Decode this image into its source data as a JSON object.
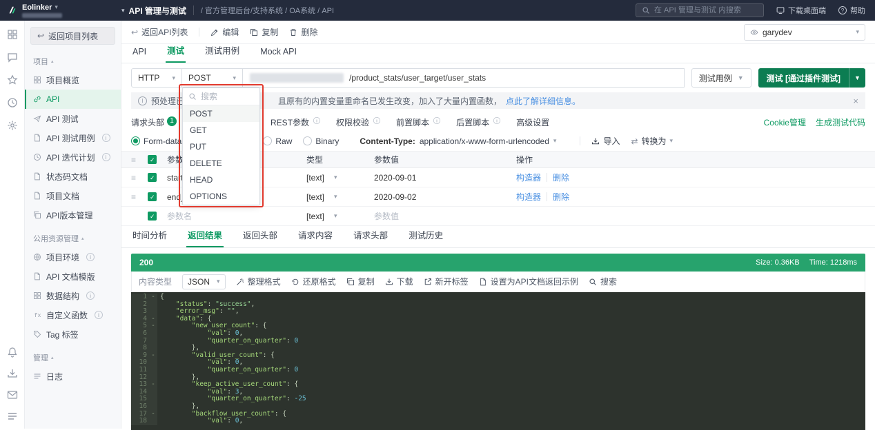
{
  "topbar": {
    "logo_text": "Eolinker",
    "app_menu": "API 管理与测试",
    "breadcrumb": "/ 官方管理后台/支持系统 / OA系统 / API",
    "search_placeholder": "在 API 管理与测试 内搜索",
    "download_desktop": "下载桌面端",
    "help": "帮助"
  },
  "icon_rail": {
    "top": [
      {
        "name": "apps-icon",
        "sym": "sy-grid"
      },
      {
        "name": "messages-icon",
        "sym": "sy-chat"
      },
      {
        "name": "favorites-icon",
        "sym": "sy-star"
      },
      {
        "name": "history-icon",
        "sym": "sy-clock"
      },
      {
        "name": "settings-icon",
        "sym": "sy-gear"
      }
    ],
    "bottom": [
      {
        "name": "notifications-icon",
        "sym": "sy-bell"
      },
      {
        "name": "download-client-icon",
        "sym": "sy-tray"
      },
      {
        "name": "feedback-icon",
        "sym": "sy-mail"
      },
      {
        "name": "menu-icon",
        "sym": "sy-list"
      }
    ]
  },
  "sidebar": {
    "back_to_projects": "返回项目列表",
    "sections": [
      {
        "title": "项目",
        "items": [
          {
            "label": "项目概览",
            "icon": "project-overview-item",
            "sym": "sy-grid"
          },
          {
            "label": "API",
            "icon": "api-item",
            "sym": "sy-link",
            "active": true
          },
          {
            "label": "API 测试",
            "icon": "api-test-item",
            "sym": "sy-send"
          },
          {
            "label": "API 测试用例",
            "icon": "api-test-case-item",
            "sym": "sy-file",
            "info": true
          },
          {
            "label": "API 迭代计划",
            "icon": "api-iteration-item",
            "sym": "sy-clock",
            "info": true
          },
          {
            "label": "状态码文档",
            "icon": "status-code-doc-item",
            "sym": "sy-file"
          },
          {
            "label": "项目文档",
            "icon": "project-doc-item",
            "sym": "sy-file"
          },
          {
            "label": "API版本管理",
            "icon": "api-version-item",
            "sym": "sy-copy"
          }
        ]
      },
      {
        "title": "公用资源管理",
        "items": [
          {
            "label": "项目环境",
            "icon": "project-env-item",
            "sym": "sy-globe",
            "info": true
          },
          {
            "label": "API 文档模版",
            "icon": "doc-template-item",
            "sym": "sy-file"
          },
          {
            "label": "数据结构",
            "icon": "data-structure-item",
            "sym": "sy-grid",
            "info": true
          },
          {
            "label": "自定义函数",
            "icon": "custom-function-item",
            "sym": "sy-fx",
            "info": true
          },
          {
            "label": "Tag 标签",
            "icon": "tag-item",
            "sym": "sy-tag"
          }
        ]
      },
      {
        "title": "管理",
        "items": [
          {
            "label": "日志",
            "icon": "log-item",
            "sym": "sy-list"
          }
        ]
      }
    ]
  },
  "detail_toolbar": {
    "back": "返回API列表",
    "edit": "编辑",
    "copy": "复制",
    "delete": "删除",
    "env_select": "garydev"
  },
  "page_tabs": [
    {
      "label": "API"
    },
    {
      "label": "测试",
      "active": true
    },
    {
      "label": "测试用例"
    },
    {
      "label": "Mock API"
    }
  ],
  "request_bar": {
    "protocol": "HTTP",
    "method": "POST",
    "path": "/product_stats/user_target/user_stats",
    "test_case_button": "测试用例",
    "test_button": "测试 [通过插件测试]"
  },
  "method_dropdown": {
    "search_placeholder": "搜索",
    "options": [
      {
        "label": "POST",
        "selected": true
      },
      {
        "label": "GET"
      },
      {
        "label": "PUT"
      },
      {
        "label": "DELETE"
      },
      {
        "label": "HEAD"
      },
      {
        "label": "OPTIONS"
      }
    ]
  },
  "notice": {
    "left_text": "预处理已更",
    "right_text": "且原有的内置变量重命名已发生改变，加入了大量内置函数，",
    "link_text": "点此了解详细信息。"
  },
  "request_tabs": {
    "headers_tab": "请求头部",
    "headers_badge": "1",
    "tabs": [
      {
        "label": "REST参数",
        "info": true
      },
      {
        "label": "权限校验",
        "info": true
      },
      {
        "label": "前置脚本",
        "info": true
      },
      {
        "label": "后置脚本",
        "info": true
      },
      {
        "label": "高级设置"
      }
    ],
    "cookie_link": "Cookie管理",
    "gen_code_link": "生成测试代码"
  },
  "body_options": {
    "radios": [
      {
        "label": "Form-data",
        "selected": true,
        "gap_after": true
      },
      {
        "label": "Raw"
      },
      {
        "label": "Binary"
      }
    ],
    "content_type_label": "Content-Type:",
    "content_type_value": "application/x-www-form-urlencoded",
    "import_label": "导入",
    "convert_label": "转换为"
  },
  "param_table": {
    "headers": {
      "name": "参数名",
      "type": "类型",
      "value": "参数值",
      "ops": "操作"
    },
    "rows": [
      {
        "name": "start_time",
        "type": "[text]",
        "value": "2020-09-01",
        "checked": true
      },
      {
        "name": "end_time",
        "type": "[text]",
        "value": "2020-09-02",
        "checked": true
      }
    ],
    "empty_row": {
      "name_placeholder": "参数名",
      "type": "[text]",
      "value_placeholder": "参数值",
      "checked": true
    },
    "ops": {
      "builder": "构造器",
      "delete": "删除"
    }
  },
  "result_tabs": [
    {
      "label": "时间分析"
    },
    {
      "label": "返回结果",
      "active": true
    },
    {
      "label": "返回头部"
    },
    {
      "label": "请求内容"
    },
    {
      "label": "请求头部"
    },
    {
      "label": "测试历史"
    }
  ],
  "result": {
    "status_code": "200",
    "size_text": "Size: 0.36KB",
    "time_text": "Time: 1218ms",
    "content_type_label": "内容类型",
    "content_type_value": "JSON",
    "actions": [
      {
        "label": "整理格式",
        "icon": "format-icon",
        "sym": "sy-wand"
      },
      {
        "label": "还原格式",
        "icon": "restore-icon",
        "sym": "sy-restore"
      },
      {
        "label": "复制",
        "icon": "copy-icon",
        "sym": "sy-copy"
      },
      {
        "label": "下载",
        "icon": "download-icon",
        "sym": "sy-tray"
      },
      {
        "label": "新开标签",
        "icon": "new-tab-icon",
        "sym": "sy-external"
      },
      {
        "label": "设置为API文档返回示例",
        "icon": "set-example-icon",
        "sym": "sy-file"
      },
      {
        "label": "搜索",
        "icon": "search-icon",
        "sym": "sy-search"
      }
    ]
  },
  "code": {
    "fold_lines": [
      1,
      4,
      5,
      9,
      13,
      17
    ],
    "lines": [
      "{",
      "    \"status\": \"success\",",
      "    \"error_msg\": \"\",",
      "    \"data\": {",
      "        \"new_user_count\": {",
      "            \"val\": 0,",
      "            \"quarter_on_quarter\": 0",
      "        },",
      "        \"valid_user_count\": {",
      "            \"val\": 0,",
      "            \"quarter_on_quarter\": 0",
      "        },",
      "        \"keep_active_user_count\": {",
      "            \"val\": 3,",
      "            \"quarter_on_quarter\": -25",
      "        },",
      "        \"backflow_user_count\": {",
      "            \"val\": 0,"
    ]
  },
  "colors": {
    "accent_green": "#0e9a62",
    "button_green": "#0c7d52",
    "status_bar_green": "#27a36d",
    "topbar_bg": "#242b3c",
    "link_blue": "#4a90e2",
    "annotation_red": "#e23a2e"
  }
}
